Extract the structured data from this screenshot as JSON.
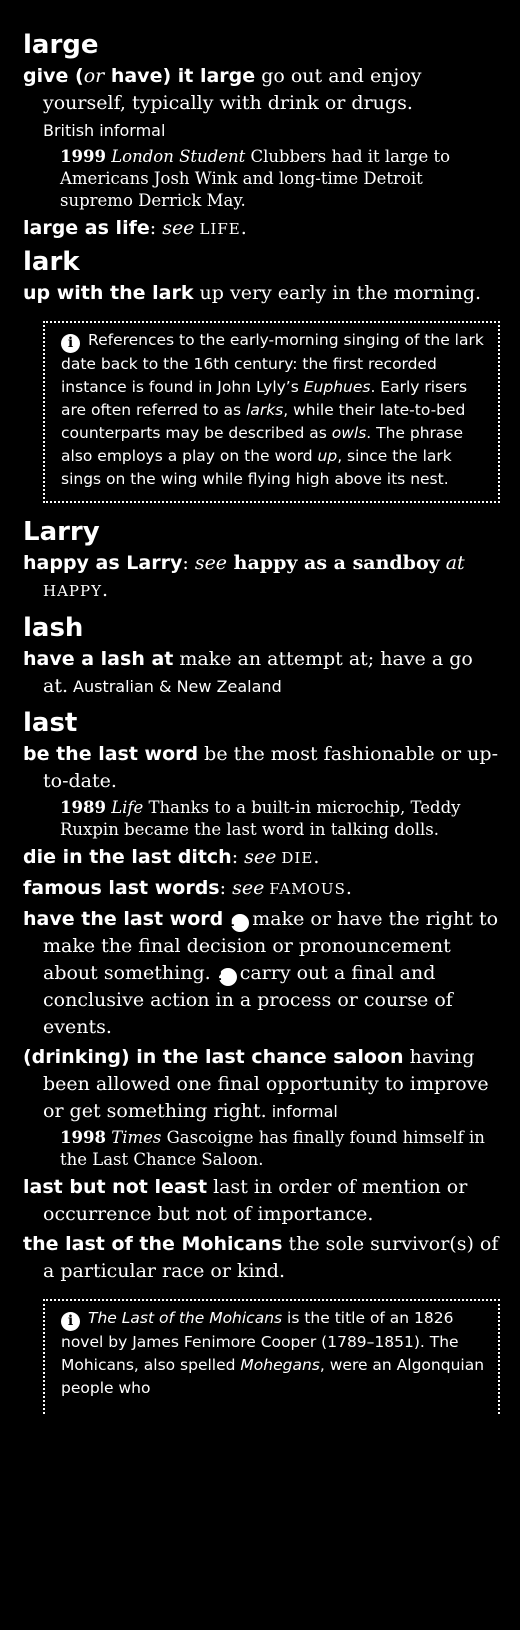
{
  "entries": {
    "large": {
      "headword": "large",
      "s1_phrase": "give (",
      "s1_phrase_or": "or",
      "s1_phrase2": " have) it large",
      "s1_def": " go out and enjoy yourself, typically with drink or drugs.",
      "s1_reg": "British informal",
      "q1_year": "1999",
      "q1_src": "London Student",
      "q1_text": " Clubbers had it large to Americans Josh Wink and long-time Detroit supremo Derrick May.",
      "s2_phrase": "large as life",
      "s2_colon": ": ",
      "s2_see": "see",
      "s2_ref": "life",
      "s2_end": "."
    },
    "lark": {
      "headword": "lark",
      "s1_phrase": "up with the lark",
      "s1_def": " up very early in the morning.",
      "note_1": "References to the early-morning singing of the lark date back to the 16th century: the first recorded instance is found in John Lyly’s ",
      "note_euphues": "Euphues",
      "note_2": ". Early risers are often referred to as ",
      "note_larks": "larks",
      "note_3": ", while their late-to-bed counterparts may be described as ",
      "note_owls": "owls",
      "note_4": ". The phrase also employs a play on the word ",
      "note_up": "up",
      "note_5": ", since the lark sings on the wing while flying high above its nest.",
      "note_icon": "i"
    },
    "larry": {
      "headword": "Larry",
      "s1_phrase": "happy as Larry",
      "s1_colon": ": ",
      "s1_see": "see",
      "s1_ref_bold": " happy as a sandboy",
      "s1_at": " at",
      "s1_ref": "happy",
      "s1_end": "."
    },
    "lash": {
      "headword": "lash",
      "s1_phrase": "have a lash at",
      "s1_def": " make an attempt at; have a go at.",
      "s1_reg": "Australian & New Zealand"
    },
    "last": {
      "headword": "last",
      "s1_phrase": "be the last word",
      "s1_def": " be the most fashionable or up-to-date.",
      "q1_year": "1989",
      "q1_src": "Life",
      "q1_text": " Thanks to a built-in microchip, Teddy Ruxpin became the last word in talking dolls.",
      "s2_phrase": "die in the last ditch",
      "s2_colon": ": ",
      "s2_see": "see",
      "s2_ref": "die",
      "s2_end": ".",
      "s3_phrase": "famous last words",
      "s3_colon": ": ",
      "s3_see": "see",
      "s3_ref": "famous",
      "s3_end": ".",
      "s4_phrase": "have the last word",
      "s4_n1": "1",
      "s4_def1": "make or have the right to make the final decision or pronouncement about something.",
      "s4_n2": "2",
      "s4_def2": "carry out a final and conclusive action in a process or course of events.",
      "s5_phrase": "(drinking) in the last chance saloon",
      "s5_def": " having been allowed one final opportunity to improve or get something right.",
      "s5_reg": "informal",
      "q2_year": "1998",
      "q2_src": "Times",
      "q2_text": " Gascoigne has finally found himself in the Last Chance Saloon.",
      "s6_phrase": "last but not least",
      "s6_def": " last in order of mention or occurrence but not of importance.",
      "s7_phrase": "the last of the Mohicans",
      "s7_def": " the sole survivor(s) of a particular race or kind.",
      "note_title": "The Last of the Mohicans",
      "note_1": " is the title of an 1826 novel by James Fenimore Cooper (1789–1851). The Mohicans, also spelled ",
      "note_mohegans": "Mohegans",
      "note_2": ", were an Algonquian people who",
      "note_icon": "i"
    }
  }
}
